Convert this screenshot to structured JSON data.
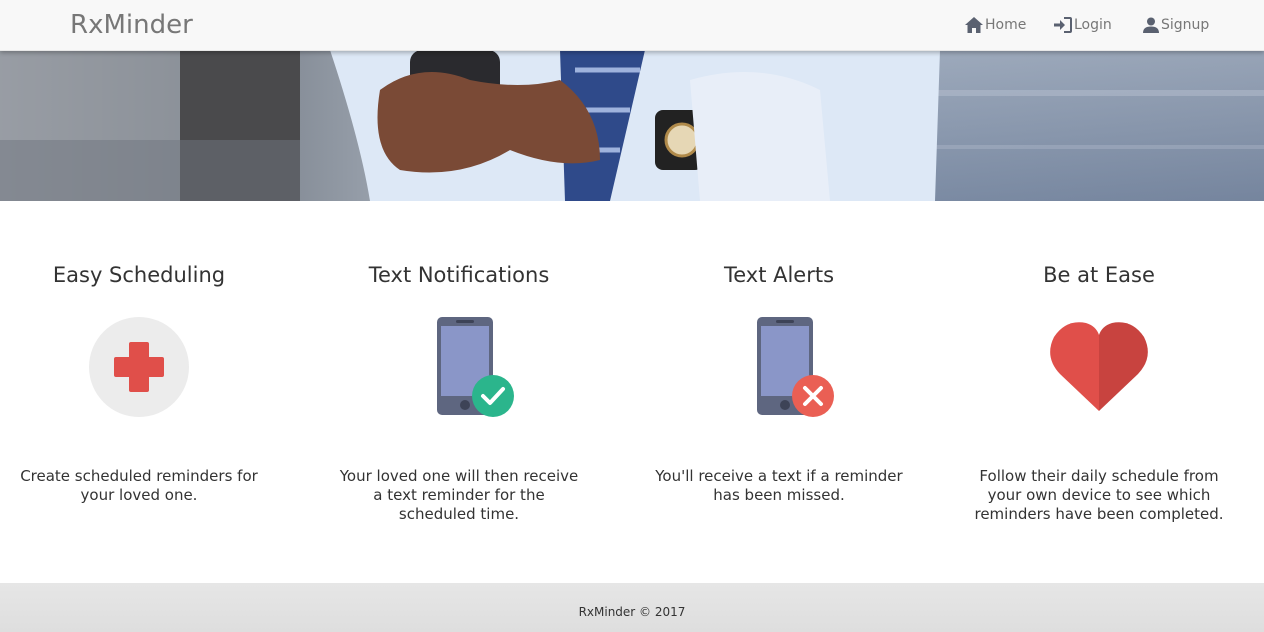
{
  "navbar": {
    "brand": "RxMinder",
    "links": [
      {
        "label": "Home",
        "icon": "home-icon"
      },
      {
        "label": "Login",
        "icon": "login-icon"
      },
      {
        "label": "Signup",
        "icon": "user-icon"
      }
    ]
  },
  "features": [
    {
      "title": "Easy Scheduling",
      "icon": "medical-cross-icon",
      "text": "Create scheduled reminders for your loved one."
    },
    {
      "title": "Text Notifications",
      "icon": "phone-check-icon",
      "text": "Your loved one will then receive a text reminder for the scheduled time."
    },
    {
      "title": "Text Alerts",
      "icon": "phone-x-icon",
      "text": "You'll receive a text if a reminder has been missed."
    },
    {
      "title": "Be at Ease",
      "icon": "heart-icon",
      "text": "Follow their daily schedule from your own device to see which reminders have been completed."
    }
  ],
  "footer": {
    "text": "RxMinder © 2017"
  },
  "colors": {
    "red": "#e04f4a",
    "phone": "#5e6680",
    "screen": "#8a96c8",
    "green": "#2bb58c",
    "alert": "#ea5f54"
  }
}
